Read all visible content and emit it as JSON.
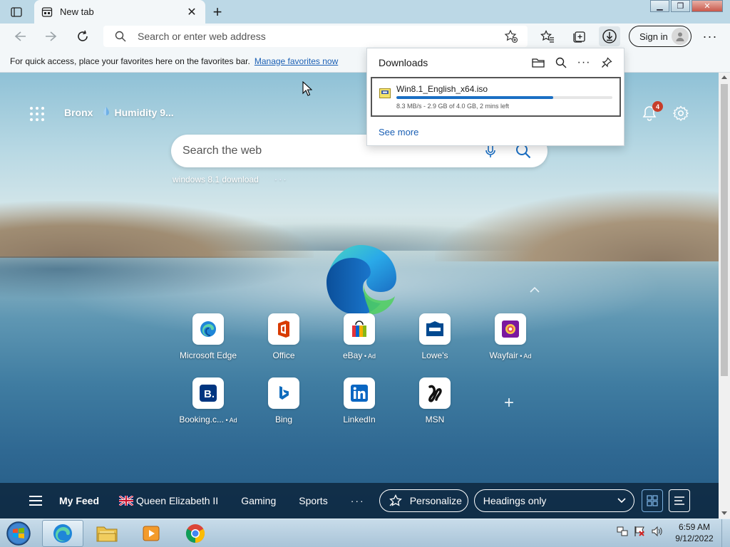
{
  "tabs": [
    {
      "title": "New tab"
    }
  ],
  "address_bar": {
    "placeholder": "Search or enter web address"
  },
  "account": {
    "sign_in_label": "Sign in"
  },
  "favorites_bar": {
    "message": "For quick access, place your favorites here on the favorites bar.",
    "link": "Manage favorites now"
  },
  "new_tab_page": {
    "weather": {
      "location": "Bronx",
      "humidity": "Humidity 9..."
    },
    "notifications_count": "4",
    "search": {
      "placeholder": "Search the web"
    },
    "trending": "windows 8.1 download",
    "quick_links": [
      {
        "name": "Microsoft Edge",
        "ad": "",
        "icon": "edge-icon"
      },
      {
        "name": "Office",
        "ad": "",
        "icon": "office-icon"
      },
      {
        "name": "eBay",
        "ad": " • Ad",
        "icon": "ebay-icon"
      },
      {
        "name": "Lowe's",
        "ad": "",
        "icon": "lowes-icon"
      },
      {
        "name": "Wayfair",
        "ad": " • Ad",
        "icon": "wayfair-icon"
      },
      {
        "name": "Booking.c...",
        "ad": " • Ad",
        "icon": "booking-icon"
      },
      {
        "name": "Bing",
        "ad": "",
        "icon": "bing-icon"
      },
      {
        "name": "LinkedIn",
        "ad": "",
        "icon": "linkedin-icon"
      },
      {
        "name": "MSN",
        "ad": "",
        "icon": "msn-icon"
      }
    ],
    "feed": {
      "items": [
        "My Feed",
        "Queen Elizabeth II",
        "Gaming",
        "Sports"
      ],
      "personalize_label": "Personalize",
      "view_select": "Headings only"
    }
  },
  "downloads": {
    "title": "Downloads",
    "item": {
      "file_name": "Win8.1_English_x64.iso",
      "status": "8.3 MB/s - 2.9 GB of 4.0 GB, 2 mins left",
      "progress": 0.725
    },
    "see_more": "See more"
  },
  "taskbar": {
    "time": "6:59 AM",
    "date": "9/12/2022"
  },
  "colors": {
    "accent": "#1a6fc4",
    "link": "#1a5fb4",
    "feed_bar": "#0e2840",
    "badge": "#c73d2a"
  }
}
